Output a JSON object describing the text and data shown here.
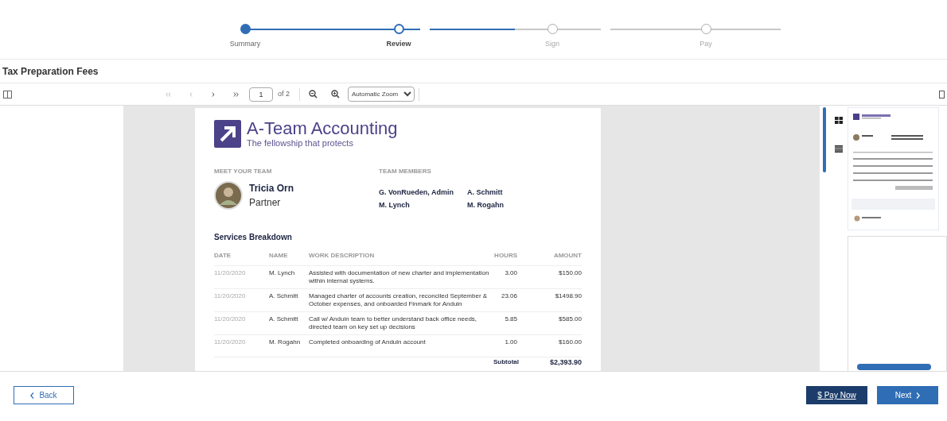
{
  "steps": [
    {
      "label": "Summary",
      "completed": true,
      "selected": false
    },
    {
      "label": "Review",
      "completed": false,
      "selected": true
    },
    {
      "label": "Sign",
      "completed": false,
      "selected": false
    },
    {
      "label": "Pay",
      "completed": false,
      "selected": false
    }
  ],
  "title": "Tax Preparation Fees",
  "toolbar": {
    "page": "1",
    "page_count": "of 2",
    "zoom": "Automatic Zoom"
  },
  "document": {
    "company": "A-Team Accounting",
    "tagline": "The fellowship that protects",
    "team_heading": "MEET YOUR TEAM",
    "contact_name": "Tricia Orn",
    "contact_role": "Partner",
    "members_heading": "TEAM MEMBERS",
    "members": [
      "G. VonRueden, Admin",
      "A. Schmitt",
      "M. Lynch",
      "M. Rogahn"
    ],
    "section": "Services Breakdown",
    "columns": [
      "DATE",
      "NAME",
      "WORK DESCRIPTION",
      "HOURS",
      "AMOUNT"
    ],
    "rows": [
      [
        "11/20/2020",
        "M. Lynch",
        "Assisted with documentation of new charter and implementation within internal systems.",
        "3.00",
        "$150.00"
      ],
      [
        "11/20/2020",
        "A. Schmitt",
        "Managed charter of accounts creation, reconciled September & October expenses, and onboarded Finmark for Anduin",
        "23.06",
        "$1498.90"
      ],
      [
        "11/20/2020",
        "A. Schmitt",
        "Call w/ Anduin team to better understand back office needs, directed team on key set up decisions",
        "5.85",
        "$585.00"
      ],
      [
        "11/20/2020",
        "M. Rogahn",
        "Completed onboarding of Anduin account",
        "1.00",
        "$160.00"
      ]
    ],
    "subtotal_label": "Subtotal",
    "subtotal": "$2,393.90"
  },
  "footer": {
    "back": "Back",
    "pay": "$ Pay Now",
    "next": "Next"
  }
}
